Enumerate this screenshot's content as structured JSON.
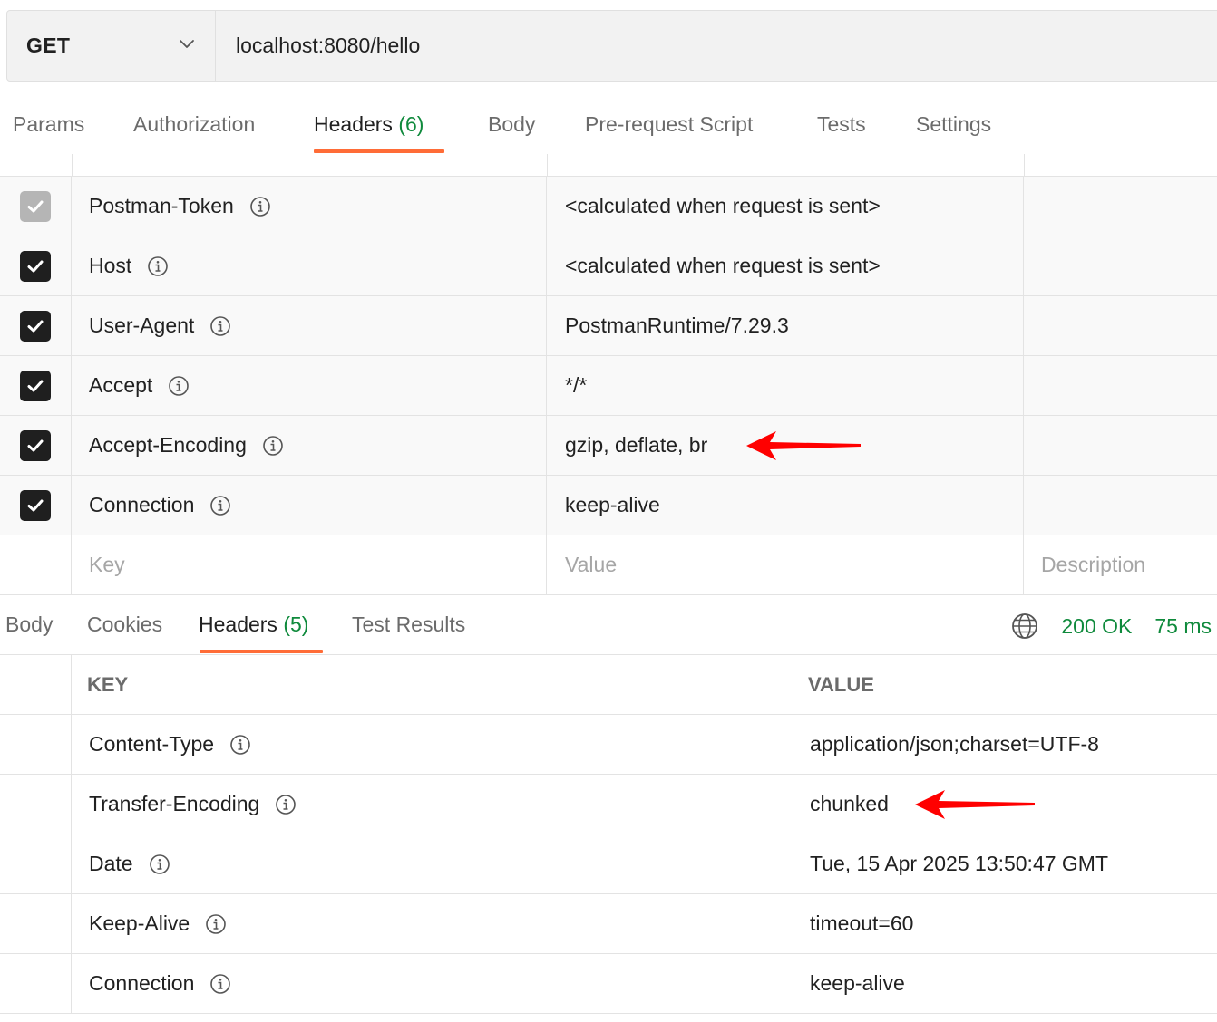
{
  "request": {
    "method": "GET",
    "url": "localhost:8080/hello"
  },
  "request_tabs": [
    {
      "label": "Params",
      "count": ""
    },
    {
      "label": "Authorization",
      "count": ""
    },
    {
      "label": "Headers",
      "count": "(6)",
      "active": true
    },
    {
      "label": "Body",
      "count": ""
    },
    {
      "label": "Pre-request Script",
      "count": ""
    },
    {
      "label": "Tests",
      "count": ""
    },
    {
      "label": "Settings",
      "count": ""
    }
  ],
  "request_headers": [
    {
      "key": "Postman-Token",
      "value": "<calculated when request is sent>",
      "checked": true,
      "disabled": true
    },
    {
      "key": "Host",
      "value": "<calculated when request is sent>",
      "checked": true,
      "disabled": false
    },
    {
      "key": "User-Agent",
      "value": "PostmanRuntime/7.29.3",
      "checked": true,
      "disabled": false
    },
    {
      "key": "Accept",
      "value": "*/*",
      "checked": true,
      "disabled": false
    },
    {
      "key": "Accept-Encoding",
      "value": "gzip, deflate, br",
      "checked": true,
      "disabled": false
    },
    {
      "key": "Connection",
      "value": "keep-alive",
      "checked": true,
      "disabled": false
    }
  ],
  "new_header": {
    "key_placeholder": "Key",
    "value_placeholder": "Value",
    "description_placeholder": "Description"
  },
  "response_tabs": [
    {
      "label": "Body",
      "count": ""
    },
    {
      "label": "Cookies",
      "count": ""
    },
    {
      "label": "Headers",
      "count": "(5)",
      "active": true
    },
    {
      "label": "Test Results",
      "count": ""
    }
  ],
  "response_status": {
    "icon": "globe-icon",
    "status": "200 OK",
    "time": "75 ms"
  },
  "response_headers_columns": {
    "key": "KEY",
    "value": "VALUE"
  },
  "response_headers": [
    {
      "key": "Content-Type",
      "value": "application/json;charset=UTF-8"
    },
    {
      "key": "Transfer-Encoding",
      "value": "chunked"
    },
    {
      "key": "Date",
      "value": "Tue, 15 Apr 2025 13:50:47 GMT"
    },
    {
      "key": "Keep-Alive",
      "value": "timeout=60"
    },
    {
      "key": "Connection",
      "value": "keep-alive"
    }
  ],
  "colors": {
    "accent": "#ff6c37",
    "success": "#0f8a3c",
    "annotation_arrow": "#ff0000"
  }
}
